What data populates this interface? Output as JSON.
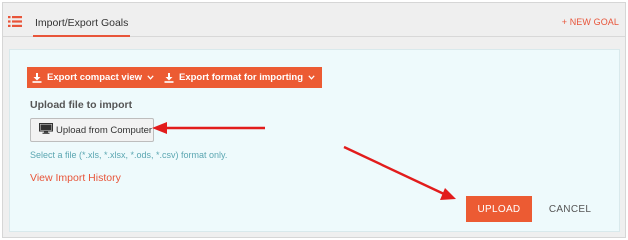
{
  "header": {
    "active_tab": "Import/Export Goals",
    "new_goal_label": "+ NEW GOAL"
  },
  "actions": {
    "export_compact_label": "Export compact view",
    "export_import_format_label": "Export format for importing"
  },
  "upload": {
    "section_label": "Upload file to import",
    "from_computer_label": "Upload from Computer",
    "hint": "Select a file (*.xls, *.xlsx, *.ods, *.csv) format only.",
    "history_link": "View Import History"
  },
  "footer": {
    "upload_label": "UPLOAD",
    "cancel_label": "CANCEL"
  },
  "colors": {
    "accent": "#ec5b33",
    "annotation_arrow": "#e21c1c",
    "panel_background": "#eefafc",
    "hint_text": "#5ba6b1"
  },
  "icons": [
    "list-menu-icon",
    "download-icon",
    "chevron-down-icon",
    "monitor-icon",
    "annotation-arrow"
  ]
}
